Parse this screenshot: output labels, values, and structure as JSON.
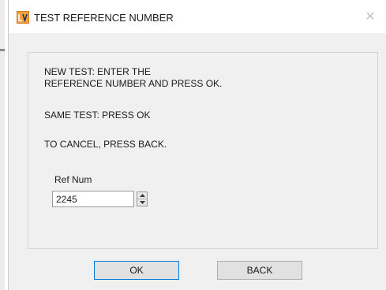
{
  "window": {
    "title": "TEST REFERENCE NUMBER",
    "app_icon": "labview-vi-icon",
    "close_glyph": "✕"
  },
  "instructions": {
    "line1": "NEW TEST:  ENTER THE",
    "line2": "REFERENCE NUMBER AND PRESS OK.",
    "line3": "SAME TEST:  PRESS OK",
    "line4": "TO CANCEL, PRESS BACK."
  },
  "ref_num": {
    "label": "Ref Num",
    "value": "2245"
  },
  "buttons": {
    "ok": "OK",
    "back": "BACK"
  },
  "colors": {
    "dialog_bg": "#f0f0f0",
    "default_button_border": "#0078d7"
  }
}
